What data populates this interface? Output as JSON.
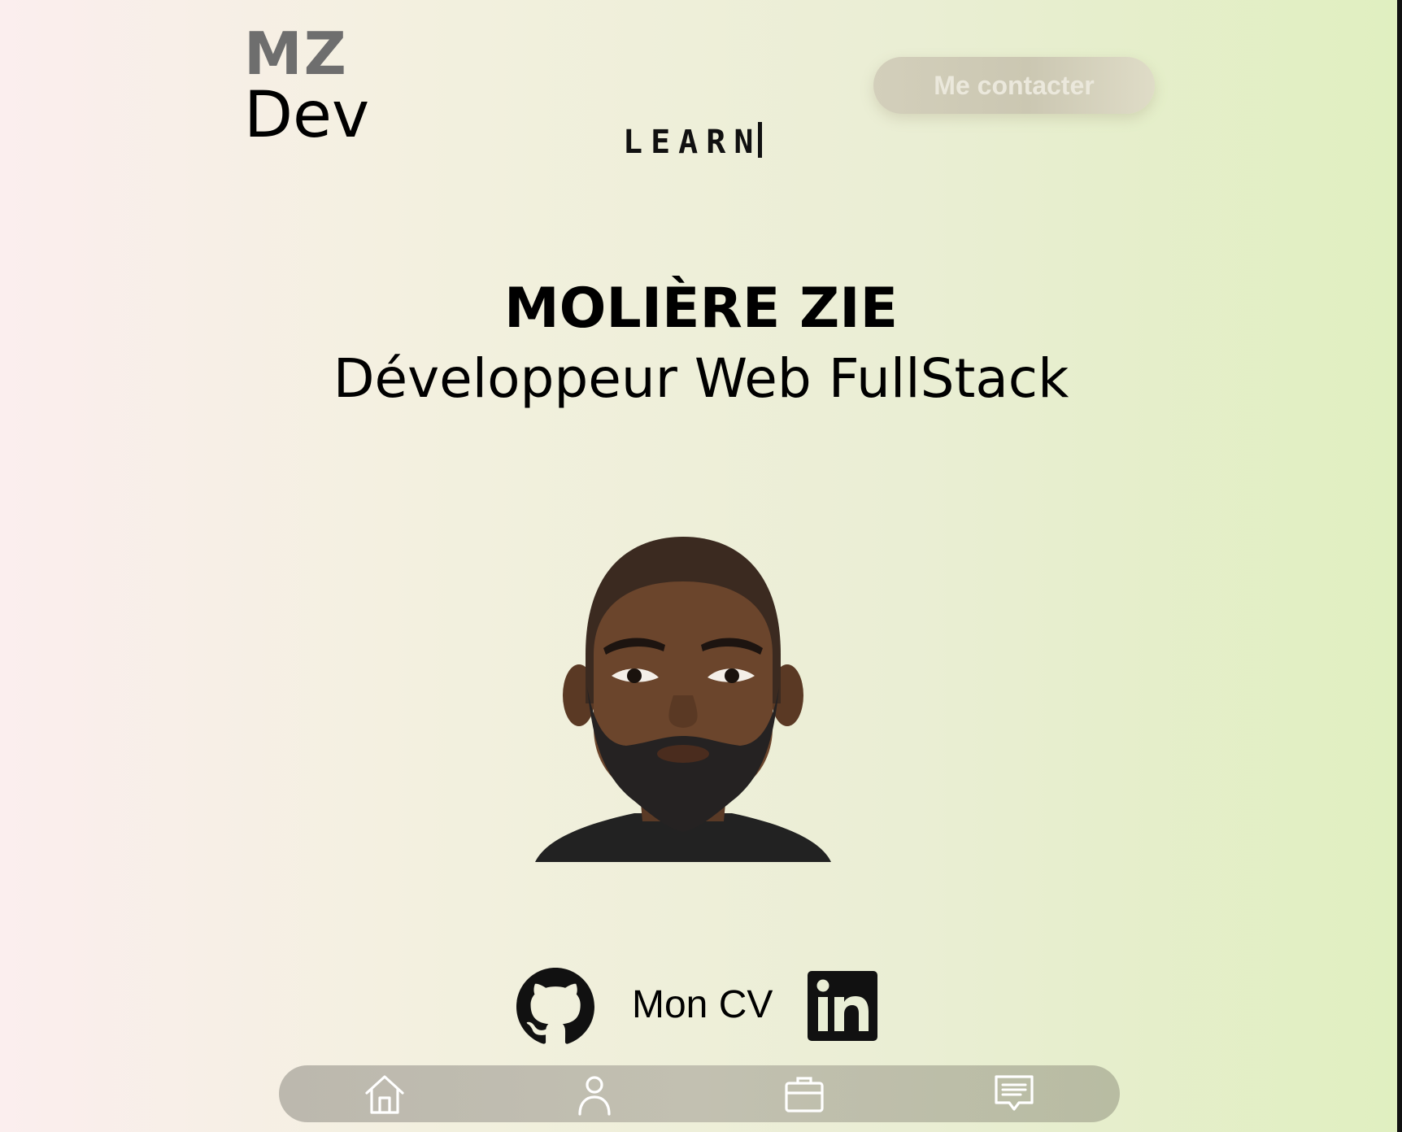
{
  "header": {
    "logo_line1": "MZ",
    "logo_line2": "Dev",
    "contact_button": "Me contacter",
    "typing_text": "LEARN"
  },
  "hero": {
    "name": "MOLIÈRE ZIE",
    "role": "Développeur Web FullStack"
  },
  "socials": {
    "cv_label": "Mon CV",
    "github_icon": "github-icon",
    "linkedin_icon": "linkedin-icon"
  },
  "bottom_nav": {
    "items": [
      "home-icon",
      "user-icon",
      "briefcase-icon",
      "message-icon"
    ]
  },
  "colors": {
    "background_left": "#fbeeee",
    "background_right": "#e0efc0",
    "contact_button": "#cbc7b2",
    "nav_bar": "#bcb8ae",
    "logo_gray": "#6e6e6e"
  }
}
